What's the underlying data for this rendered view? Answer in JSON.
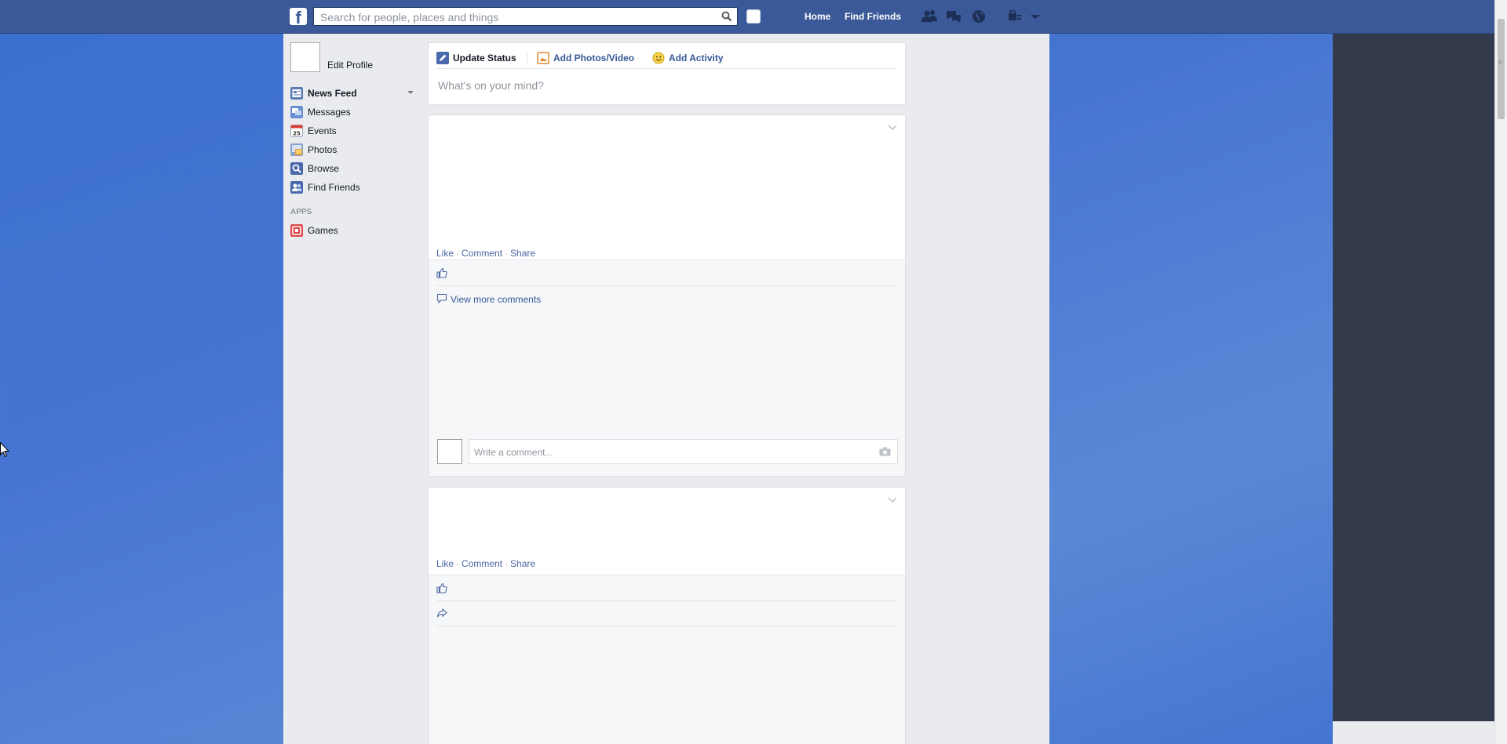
{
  "header": {
    "search_placeholder": "Search for people, places and things",
    "nav": [
      "Home",
      "Find Friends"
    ]
  },
  "left_nav": {
    "edit_profile": "Edit Profile",
    "items": [
      {
        "label": "News Feed",
        "icon": "news-feed-icon"
      },
      {
        "label": "Messages",
        "icon": "messages-icon"
      },
      {
        "label": "Events",
        "icon": "events-icon"
      },
      {
        "label": "Photos",
        "icon": "photos-icon"
      },
      {
        "label": "Browse",
        "icon": "browse-icon"
      },
      {
        "label": "Find Friends",
        "icon": "find-friends-icon"
      }
    ],
    "apps_heading": "APPS",
    "apps": [
      {
        "label": "Games",
        "icon": "games-icon"
      }
    ]
  },
  "composer": {
    "tabs": [
      "Update Status",
      "Add Photos/Video",
      "Add Activity"
    ],
    "placeholder": "What's on your mind?"
  },
  "post_actions": {
    "like": "Like",
    "comment": "Comment",
    "share": "Share"
  },
  "post1": {
    "view_more_comments": "View more comments",
    "comment_placeholder": "Write a comment..."
  },
  "colors": {
    "brand": "#3b5998",
    "link": "#365899",
    "page_bg": "#e9ebee",
    "dark_panel": "#323a4c"
  }
}
